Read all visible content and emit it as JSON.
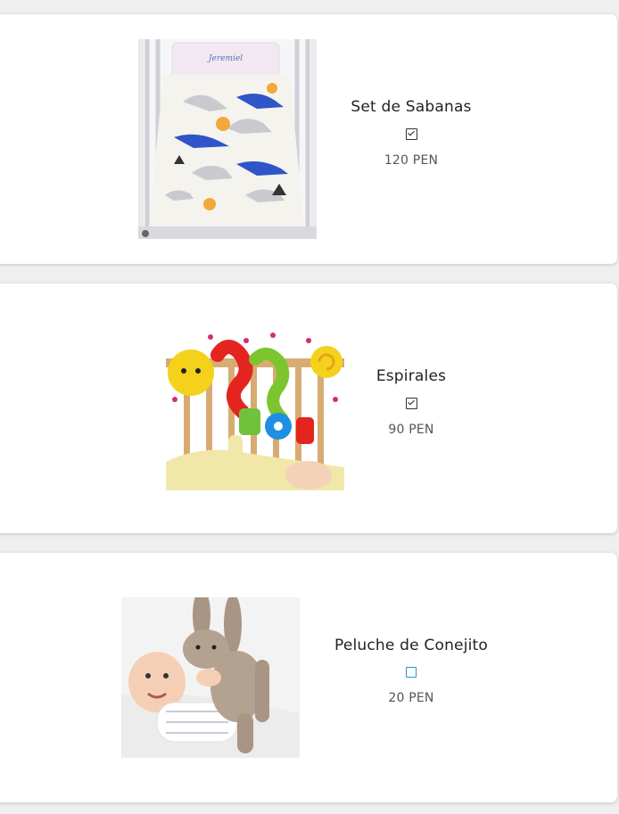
{
  "products": [
    {
      "name": "Set de Sabanas",
      "checked": true,
      "price": "120 PEN",
      "icon": "crib-sheet-set-photo"
    },
    {
      "name": "Espirales",
      "checked": true,
      "price": "90 PEN",
      "icon": "spiral-crib-toy-photo"
    },
    {
      "name": "Peluche de Conejito",
      "checked": false,
      "price": "20 PEN",
      "icon": "bunny-plush-photo"
    }
  ],
  "colors": {
    "background": "#efefef",
    "card": "#ffffff",
    "checkbox_unchecked": "#2a8fd0"
  }
}
